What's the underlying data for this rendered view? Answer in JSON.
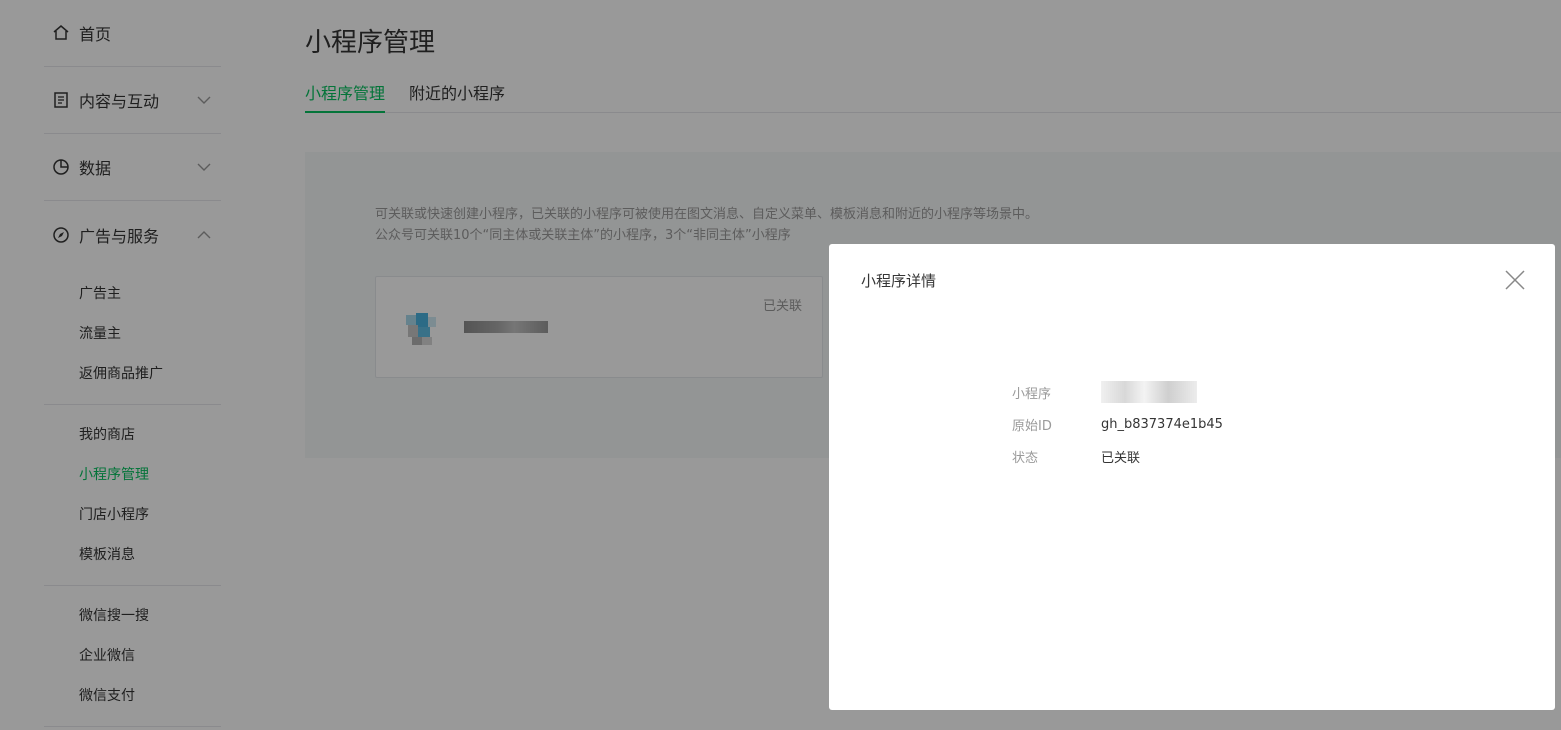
{
  "sidebar": {
    "home": {
      "label": "首页"
    },
    "content": {
      "label": "内容与互动"
    },
    "data": {
      "label": "数据"
    },
    "ads": {
      "label": "广告与服务"
    },
    "groups": [
      {
        "items": [
          {
            "label": "广告主"
          },
          {
            "label": "流量主"
          },
          {
            "label": "返佣商品推广"
          }
        ]
      },
      {
        "items": [
          {
            "label": "我的商店"
          },
          {
            "label": "小程序管理",
            "active": true
          },
          {
            "label": "门店小程序"
          },
          {
            "label": "模板消息"
          }
        ]
      },
      {
        "items": [
          {
            "label": "微信搜一搜"
          },
          {
            "label": "企业微信"
          },
          {
            "label": "微信支付"
          }
        ]
      }
    ]
  },
  "main": {
    "title": "小程序管理",
    "tabs": [
      {
        "label": "小程序管理",
        "active": true
      },
      {
        "label": "附近的小程序"
      }
    ],
    "desc_line1": "可关联或快速创建小程序，已关联的小程序可被使用在图文消息、自定义菜单、模板消息和附近的小程序等场景中。",
    "desc_line2": "公众号可关联10个“同主体或关联主体”的小程序，3个“非同主体”小程序",
    "mini_program_card": {
      "status": "已关联"
    }
  },
  "dialog": {
    "title": "小程序详情",
    "rows": [
      {
        "label": "小程序",
        "value": ""
      },
      {
        "label": "原始ID",
        "value": "gh_b837374e1b45"
      },
      {
        "label": "状态",
        "value": "已关联"
      }
    ]
  },
  "colors": {
    "accent": "#07c160",
    "overlay": "rgba(0,0,0,0.4)"
  }
}
